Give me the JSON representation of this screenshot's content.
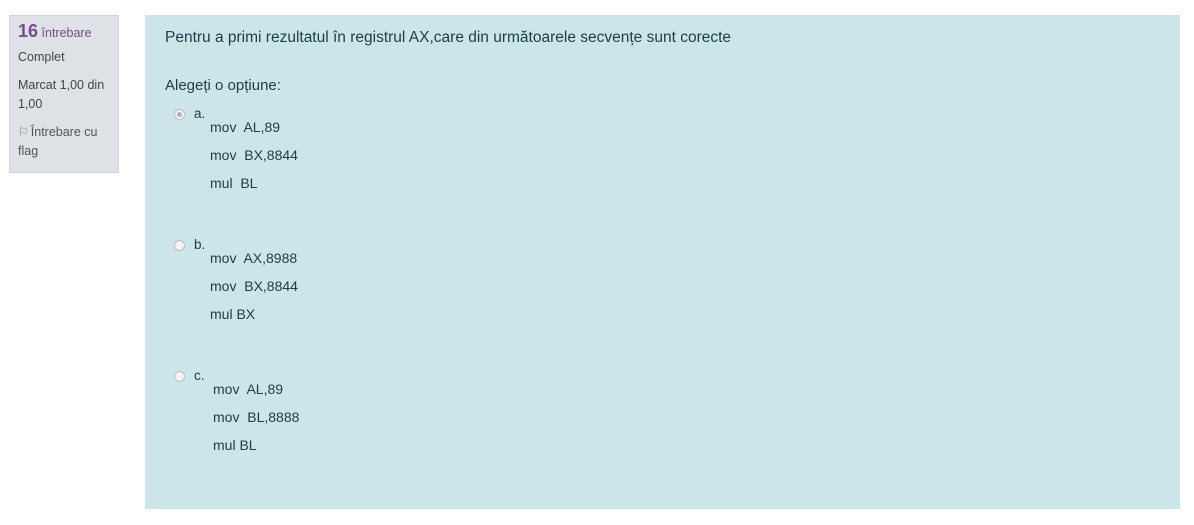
{
  "info": {
    "number": "16",
    "number_label": "întrebare",
    "state": "Complet",
    "grade": "Marcat 1,00 din 1,00",
    "flag_label": "Întrebare cu flag"
  },
  "question": {
    "text": "Pentru a primi rezultatul în registrul AX,care din următoarele secvențe sunt corecte",
    "prompt": "Alegeți o opțiune:",
    "options": [
      {
        "letter": "a.",
        "lines": [
          "mov  AL,89",
          "mov  BX,8844",
          "mul  BL"
        ]
      },
      {
        "letter": "b.",
        "lines": [
          "mov  AX,8988",
          "mov  BX,8844",
          "mul BX"
        ]
      },
      {
        "letter": "c.",
        "lines": [
          "mov  AL,89",
          "mov  BL,8888",
          "mul BL"
        ]
      }
    ]
  }
}
